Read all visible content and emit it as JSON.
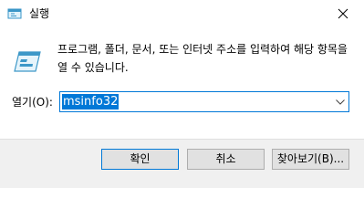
{
  "window": {
    "title": "실행"
  },
  "main": {
    "description": "프로그램, 폴더, 문서, 또는 인터넷 주소를 입력하여 해당 항목을 열 수 있습니다.",
    "open_label": "열기(O):",
    "open_value": "msinfo32"
  },
  "buttons": {
    "ok": "확인",
    "cancel": "취소",
    "browse": "찾아보기(B)..."
  },
  "icons": {
    "app": "run-icon",
    "close": "close-icon",
    "dropdown": "chevron-down-icon"
  },
  "colors": {
    "accent": "#0078d7",
    "footer_bg": "#f0f0f0"
  }
}
